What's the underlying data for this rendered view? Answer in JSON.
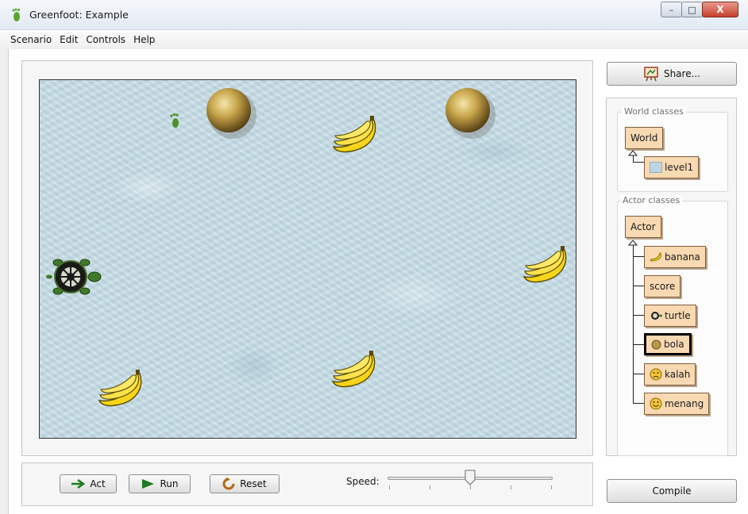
{
  "window": {
    "title": "Greenfoot: Example",
    "minimize_glyph": "–",
    "maximize_glyph": "□",
    "close_glyph": "X"
  },
  "menu": [
    "Scenario",
    "Edit",
    "Controls",
    "Help"
  ],
  "world_actors": [
    {
      "type": "footprint",
      "icon": "footprint-icon"
    },
    {
      "type": "bola",
      "icon": "ball-icon"
    },
    {
      "type": "bola",
      "icon": "ball-icon"
    },
    {
      "type": "banana",
      "icon": "banana-icon"
    },
    {
      "type": "banana",
      "icon": "banana-icon"
    },
    {
      "type": "banana",
      "icon": "banana-icon"
    },
    {
      "type": "banana",
      "icon": "banana-icon"
    },
    {
      "type": "turtle",
      "icon": "turtle-icon"
    }
  ],
  "controls": {
    "act_label": "Act",
    "run_label": "Run",
    "reset_label": "Reset",
    "speed_label": "Speed:",
    "speed_value": 0.5
  },
  "share_label": "Share...",
  "compile_label": "Compile",
  "world_classes": {
    "title": "World classes",
    "root": "World",
    "children": [
      "level1"
    ]
  },
  "actor_classes": {
    "title": "Actor classes",
    "root": "Actor",
    "children": [
      "banana",
      "score",
      "turtle",
      "bola",
      "kalah",
      "menang"
    ],
    "selected": "bola"
  },
  "colors": {
    "class_fill": "#f9d9b2",
    "world_bg": "#c6dce4",
    "banana": "#f6d51a",
    "ball": "#c8a550"
  }
}
